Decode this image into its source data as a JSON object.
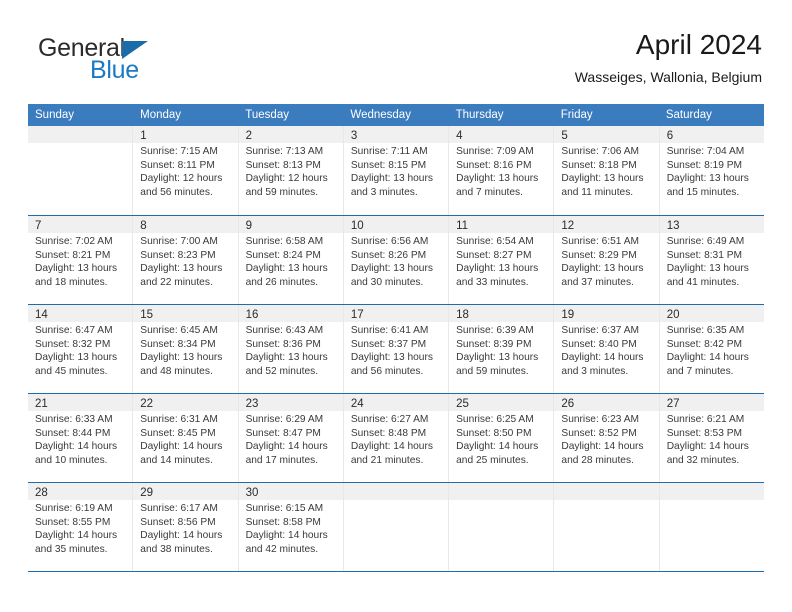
{
  "brand": {
    "name_part1": "General",
    "name_part2": "Blue",
    "triangle_color": "#1b6ca8",
    "blue_color": "#1a7ac4"
  },
  "header": {
    "title": "April 2024",
    "subtitle": "Wasseiges, Wallonia, Belgium"
  },
  "theme": {
    "header_blue": "#3a7cbe",
    "rule_blue": "#1f6bb0",
    "daynum_band": "#f0f0f0"
  },
  "weekdays": [
    "Sunday",
    "Monday",
    "Tuesday",
    "Wednesday",
    "Thursday",
    "Friday",
    "Saturday"
  ],
  "weeks": [
    [
      {
        "day": "",
        "lines": []
      },
      {
        "day": "1",
        "lines": [
          "Sunrise: 7:15 AM",
          "Sunset: 8:11 PM",
          "Daylight: 12 hours",
          "and 56 minutes."
        ]
      },
      {
        "day": "2",
        "lines": [
          "Sunrise: 7:13 AM",
          "Sunset: 8:13 PM",
          "Daylight: 12 hours",
          "and 59 minutes."
        ]
      },
      {
        "day": "3",
        "lines": [
          "Sunrise: 7:11 AM",
          "Sunset: 8:15 PM",
          "Daylight: 13 hours",
          "and 3 minutes."
        ]
      },
      {
        "day": "4",
        "lines": [
          "Sunrise: 7:09 AM",
          "Sunset: 8:16 PM",
          "Daylight: 13 hours",
          "and 7 minutes."
        ]
      },
      {
        "day": "5",
        "lines": [
          "Sunrise: 7:06 AM",
          "Sunset: 8:18 PM",
          "Daylight: 13 hours",
          "and 11 minutes."
        ]
      },
      {
        "day": "6",
        "lines": [
          "Sunrise: 7:04 AM",
          "Sunset: 8:19 PM",
          "Daylight: 13 hours",
          "and 15 minutes."
        ]
      }
    ],
    [
      {
        "day": "7",
        "lines": [
          "Sunrise: 7:02 AM",
          "Sunset: 8:21 PM",
          "Daylight: 13 hours",
          "and 18 minutes."
        ]
      },
      {
        "day": "8",
        "lines": [
          "Sunrise: 7:00 AM",
          "Sunset: 8:23 PM",
          "Daylight: 13 hours",
          "and 22 minutes."
        ]
      },
      {
        "day": "9",
        "lines": [
          "Sunrise: 6:58 AM",
          "Sunset: 8:24 PM",
          "Daylight: 13 hours",
          "and 26 minutes."
        ]
      },
      {
        "day": "10",
        "lines": [
          "Sunrise: 6:56 AM",
          "Sunset: 8:26 PM",
          "Daylight: 13 hours",
          "and 30 minutes."
        ]
      },
      {
        "day": "11",
        "lines": [
          "Sunrise: 6:54 AM",
          "Sunset: 8:27 PM",
          "Daylight: 13 hours",
          "and 33 minutes."
        ]
      },
      {
        "day": "12",
        "lines": [
          "Sunrise: 6:51 AM",
          "Sunset: 8:29 PM",
          "Daylight: 13 hours",
          "and 37 minutes."
        ]
      },
      {
        "day": "13",
        "lines": [
          "Sunrise: 6:49 AM",
          "Sunset: 8:31 PM",
          "Daylight: 13 hours",
          "and 41 minutes."
        ]
      }
    ],
    [
      {
        "day": "14",
        "lines": [
          "Sunrise: 6:47 AM",
          "Sunset: 8:32 PM",
          "Daylight: 13 hours",
          "and 45 minutes."
        ]
      },
      {
        "day": "15",
        "lines": [
          "Sunrise: 6:45 AM",
          "Sunset: 8:34 PM",
          "Daylight: 13 hours",
          "and 48 minutes."
        ]
      },
      {
        "day": "16",
        "lines": [
          "Sunrise: 6:43 AM",
          "Sunset: 8:36 PM",
          "Daylight: 13 hours",
          "and 52 minutes."
        ]
      },
      {
        "day": "17",
        "lines": [
          "Sunrise: 6:41 AM",
          "Sunset: 8:37 PM",
          "Daylight: 13 hours",
          "and 56 minutes."
        ]
      },
      {
        "day": "18",
        "lines": [
          "Sunrise: 6:39 AM",
          "Sunset: 8:39 PM",
          "Daylight: 13 hours",
          "and 59 minutes."
        ]
      },
      {
        "day": "19",
        "lines": [
          "Sunrise: 6:37 AM",
          "Sunset: 8:40 PM",
          "Daylight: 14 hours",
          "and 3 minutes."
        ]
      },
      {
        "day": "20",
        "lines": [
          "Sunrise: 6:35 AM",
          "Sunset: 8:42 PM",
          "Daylight: 14 hours",
          "and 7 minutes."
        ]
      }
    ],
    [
      {
        "day": "21",
        "lines": [
          "Sunrise: 6:33 AM",
          "Sunset: 8:44 PM",
          "Daylight: 14 hours",
          "and 10 minutes."
        ]
      },
      {
        "day": "22",
        "lines": [
          "Sunrise: 6:31 AM",
          "Sunset: 8:45 PM",
          "Daylight: 14 hours",
          "and 14 minutes."
        ]
      },
      {
        "day": "23",
        "lines": [
          "Sunrise: 6:29 AM",
          "Sunset: 8:47 PM",
          "Daylight: 14 hours",
          "and 17 minutes."
        ]
      },
      {
        "day": "24",
        "lines": [
          "Sunrise: 6:27 AM",
          "Sunset: 8:48 PM",
          "Daylight: 14 hours",
          "and 21 minutes."
        ]
      },
      {
        "day": "25",
        "lines": [
          "Sunrise: 6:25 AM",
          "Sunset: 8:50 PM",
          "Daylight: 14 hours",
          "and 25 minutes."
        ]
      },
      {
        "day": "26",
        "lines": [
          "Sunrise: 6:23 AM",
          "Sunset: 8:52 PM",
          "Daylight: 14 hours",
          "and 28 minutes."
        ]
      },
      {
        "day": "27",
        "lines": [
          "Sunrise: 6:21 AM",
          "Sunset: 8:53 PM",
          "Daylight: 14 hours",
          "and 32 minutes."
        ]
      }
    ],
    [
      {
        "day": "28",
        "lines": [
          "Sunrise: 6:19 AM",
          "Sunset: 8:55 PM",
          "Daylight: 14 hours",
          "and 35 minutes."
        ]
      },
      {
        "day": "29",
        "lines": [
          "Sunrise: 6:17 AM",
          "Sunset: 8:56 PM",
          "Daylight: 14 hours",
          "and 38 minutes."
        ]
      },
      {
        "day": "30",
        "lines": [
          "Sunrise: 6:15 AM",
          "Sunset: 8:58 PM",
          "Daylight: 14 hours",
          "and 42 minutes."
        ]
      },
      {
        "day": "",
        "lines": []
      },
      {
        "day": "",
        "lines": []
      },
      {
        "day": "",
        "lines": []
      },
      {
        "day": "",
        "lines": []
      }
    ]
  ]
}
